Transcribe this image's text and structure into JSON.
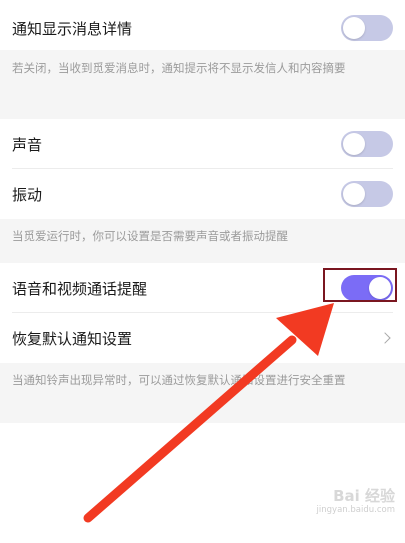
{
  "sections": {
    "group1": {
      "notification_details": {
        "label": "通知显示消息详情",
        "toggle_on": false
      },
      "note": "若关闭，当收到觅爱消息时，通知提示将不显示发信人和内容摘要"
    },
    "group2": {
      "sound": {
        "label": "声音",
        "toggle_on": false
      },
      "vibration": {
        "label": "振动",
        "toggle_on": false
      },
      "note": "当觅爱运行时，你可以设置是否需要声音或者振动提醒"
    },
    "group3": {
      "voice_video_reminder": {
        "label": "语音和视频通话提醒",
        "toggle_on": true
      },
      "restore_defaults": {
        "label": "恢复默认通知设置"
      },
      "note": "当通知铃声出现异常时，可以通过恢复默认通知设置进行安全重置"
    }
  },
  "watermark": {
    "main": "Bai 经验",
    "sub": "jingyan.baidu.com"
  },
  "colors": {
    "toggle_off": "#c6c9e6",
    "toggle_on": "#7b6cf6",
    "highlight_box": "#7a1620",
    "arrow": "#f23a22"
  },
  "icons": {
    "restore_defaults": "chevron-right-icon"
  }
}
